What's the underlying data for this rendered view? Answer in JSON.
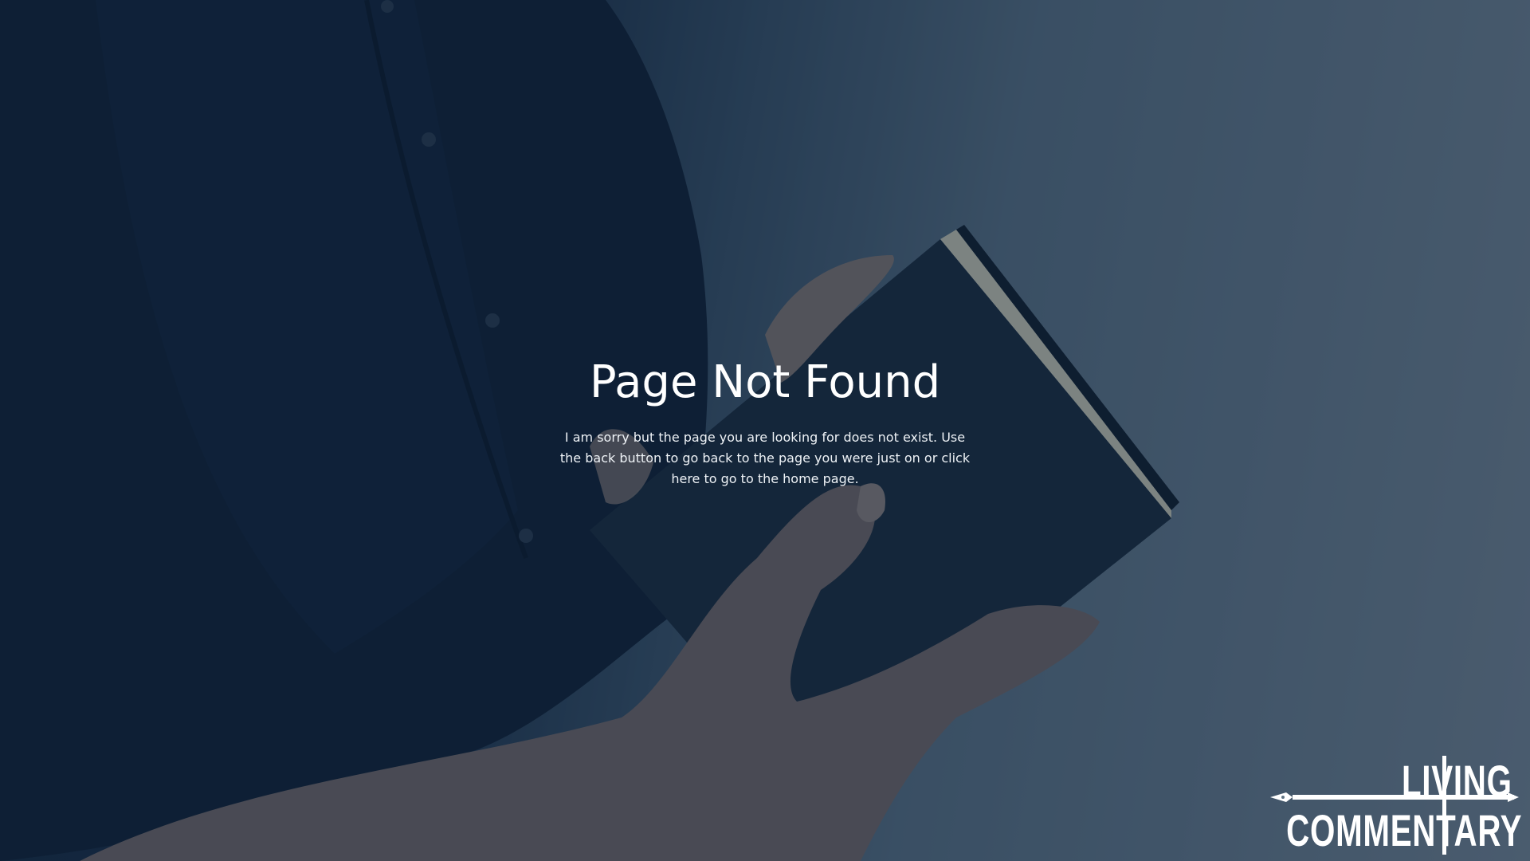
{
  "page": {
    "title": "Page Not Found",
    "message_part1": "I am sorry but the page you are looking for does not exist. Use the back button to go back to the page you were just on or click ",
    "message_link": "here",
    "message_part2": " to go to the home page."
  },
  "logo": {
    "line1": "LIVING",
    "line2": "COMMENTARY"
  },
  "colors": {
    "overlay": "#0e243e",
    "text": "#ffffff"
  },
  "background": {
    "icon": "person-holding-book-photo"
  }
}
